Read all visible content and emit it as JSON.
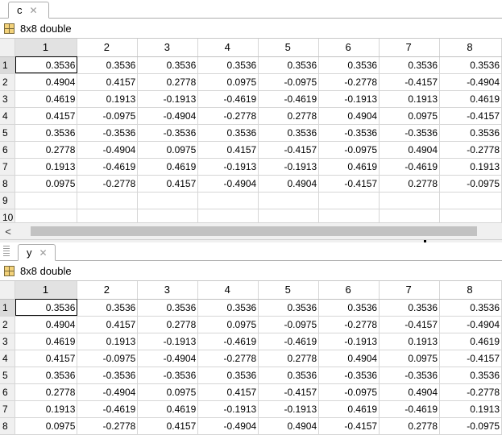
{
  "panels": [
    {
      "tab_label": "c",
      "close_glyph": "✕",
      "type_label": "8x8 double",
      "columns": [
        "1",
        "2",
        "3",
        "4",
        "5",
        "6",
        "7",
        "8"
      ],
      "row_labels": [
        "1",
        "2",
        "3",
        "4",
        "5",
        "6",
        "7",
        "8",
        "9",
        "10"
      ],
      "rows": [
        [
          "0.3536",
          "0.3536",
          "0.3536",
          "0.3536",
          "0.3536",
          "0.3536",
          "0.3536",
          "0.3536"
        ],
        [
          "0.4904",
          "0.4157",
          "0.2778",
          "0.0975",
          "-0.0975",
          "-0.2778",
          "-0.4157",
          "-0.4904"
        ],
        [
          "0.4619",
          "0.1913",
          "-0.1913",
          "-0.4619",
          "-0.4619",
          "-0.1913",
          "0.1913",
          "0.4619"
        ],
        [
          "0.4157",
          "-0.0975",
          "-0.4904",
          "-0.2778",
          "0.2778",
          "0.4904",
          "0.0975",
          "-0.4157"
        ],
        [
          "0.3536",
          "-0.3536",
          "-0.3536",
          "0.3536",
          "0.3536",
          "-0.3536",
          "-0.3536",
          "0.3536"
        ],
        [
          "0.2778",
          "-0.4904",
          "0.0975",
          "0.4157",
          "-0.4157",
          "-0.0975",
          "0.4904",
          "-0.2778"
        ],
        [
          "0.1913",
          "-0.4619",
          "0.4619",
          "-0.1913",
          "-0.1913",
          "0.4619",
          "-0.4619",
          "0.1913"
        ],
        [
          "0.0975",
          "-0.2778",
          "0.4157",
          "-0.4904",
          "0.4904",
          "-0.4157",
          "0.2778",
          "-0.0975"
        ],
        [
          "",
          "",
          "",
          "",
          "",
          "",
          "",
          ""
        ],
        [
          "",
          "",
          "",
          "",
          "",
          "",
          "",
          ""
        ]
      ],
      "scroll_left_glyph": "<"
    },
    {
      "tab_label": "y",
      "close_glyph": "✕",
      "type_label": "8x8 double",
      "columns": [
        "1",
        "2",
        "3",
        "4",
        "5",
        "6",
        "7",
        "8"
      ],
      "row_labels": [
        "1",
        "2",
        "3",
        "4",
        "5",
        "6",
        "7",
        "8"
      ],
      "rows": [
        [
          "0.3536",
          "0.3536",
          "0.3536",
          "0.3536",
          "0.3536",
          "0.3536",
          "0.3536",
          "0.3536"
        ],
        [
          "0.4904",
          "0.4157",
          "0.2778",
          "0.0975",
          "-0.0975",
          "-0.2778",
          "-0.4157",
          "-0.4904"
        ],
        [
          "0.4619",
          "0.1913",
          "-0.1913",
          "-0.4619",
          "-0.4619",
          "-0.1913",
          "0.1913",
          "0.4619"
        ],
        [
          "0.4157",
          "-0.0975",
          "-0.4904",
          "-0.2778",
          "0.2778",
          "0.4904",
          "0.0975",
          "-0.4157"
        ],
        [
          "0.3536",
          "-0.3536",
          "-0.3536",
          "0.3536",
          "0.3536",
          "-0.3536",
          "-0.3536",
          "0.3536"
        ],
        [
          "0.2778",
          "-0.4904",
          "0.0975",
          "0.4157",
          "-0.4157",
          "-0.0975",
          "0.4904",
          "-0.2778"
        ],
        [
          "0.1913",
          "-0.4619",
          "0.4619",
          "-0.1913",
          "-0.1913",
          "0.4619",
          "-0.4619",
          "0.1913"
        ],
        [
          "0.0975",
          "-0.2778",
          "0.4157",
          "-0.4904",
          "0.4904",
          "-0.4157",
          "0.2778",
          "-0.0975"
        ]
      ]
    }
  ]
}
